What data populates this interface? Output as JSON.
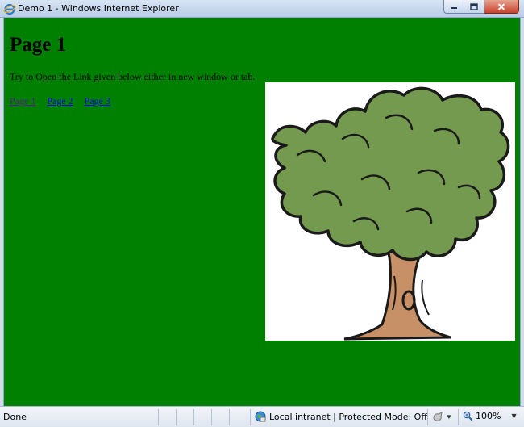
{
  "window": {
    "title": "Demo 1 - Windows Internet Explorer"
  },
  "page": {
    "heading": "Page 1",
    "paragraph": "Try to Open the Link given below either in new window or tab.",
    "links": [
      {
        "label": "Page 1",
        "state": "visited"
      },
      {
        "label": "Page 2",
        "state": "normal"
      },
      {
        "label": "Page 3",
        "state": "normal"
      }
    ],
    "image": {
      "icon": "tree-illustration"
    },
    "background_color": "#008000"
  },
  "statusbar": {
    "status": "Done",
    "zone": "Local intranet | Protected Mode: Off",
    "zoom": "100%"
  },
  "icons": {
    "app": "ie-icon",
    "minimize": "minimize-icon",
    "maximize": "maximize-icon",
    "close": "close-icon",
    "zone": "globe-icon",
    "security": "security-icon",
    "zoom": "zoom-icon"
  }
}
